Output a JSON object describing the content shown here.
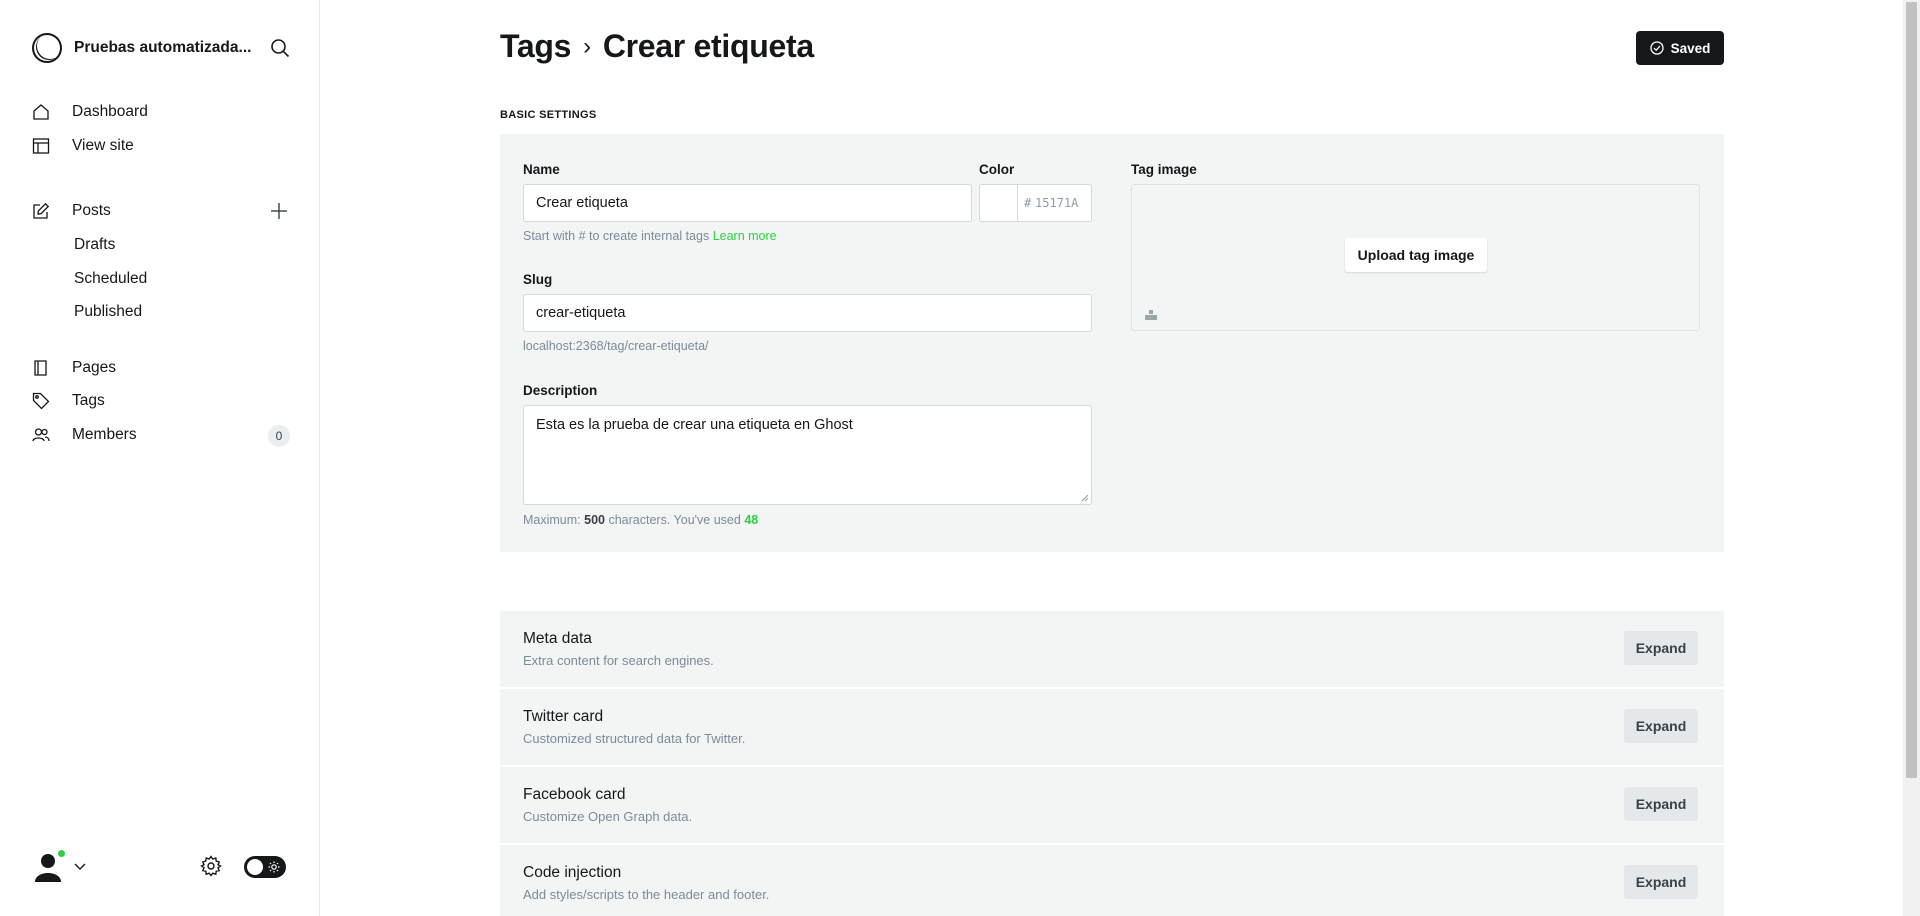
{
  "sidebar": {
    "site_title": "Pruebas automatizada...",
    "nav": {
      "dashboard": "Dashboard",
      "view_site": "View site",
      "posts": "Posts",
      "drafts": "Drafts",
      "scheduled": "Scheduled",
      "published": "Published",
      "pages": "Pages",
      "tags": "Tags",
      "members": "Members",
      "members_count": "0"
    },
    "icons": [
      "search-icon",
      "home-icon",
      "layout-icon",
      "pencil-icon",
      "plus-icon",
      "book-icon",
      "tag-icon",
      "users-icon",
      "user-icon",
      "chevron-down-icon",
      "gear-icon",
      "sun-icon"
    ]
  },
  "header": {
    "breadcrumb_parent": "Tags",
    "breadcrumb_sep": "›",
    "breadcrumb_current": "Crear etiqueta",
    "saved_label": "Saved"
  },
  "basic_settings": {
    "section_title": "BASIC SETTINGS",
    "name_label": "Name",
    "name_value": "Crear etiqueta",
    "name_hint": "Start with # to create internal tags",
    "name_hint_link": "Learn more",
    "color_label": "Color",
    "color_hash": "#",
    "color_placeholder": "15171A",
    "slug_label": "Slug",
    "slug_value": "crear-etiqueta",
    "slug_hint": "localhost:2368/tag/crear-etiqueta/",
    "description_label": "Description",
    "description_value": "Esta es la prueba de crear una etiqueta en Ghost",
    "desc_hint_prefix": "Maximum:",
    "desc_hint_max": "500",
    "desc_hint_mid": "characters. You've used",
    "desc_hint_used": "48",
    "tag_image_label": "Tag image",
    "upload_label": "Upload tag image"
  },
  "expandables": [
    {
      "title": "Meta data",
      "desc": "Extra content for search engines.",
      "button": "Expand"
    },
    {
      "title": "Twitter card",
      "desc": "Customized structured data for Twitter.",
      "button": "Expand"
    },
    {
      "title": "Facebook card",
      "desc": "Customize Open Graph data.",
      "button": "Expand"
    },
    {
      "title": "Code injection",
      "desc": "Add styles/scripts to the header and footer.",
      "button": "Expand"
    }
  ],
  "colors": {
    "accent_green": "#30cf43",
    "dark": "#15171a",
    "card_bg": "#f3f5f4"
  }
}
